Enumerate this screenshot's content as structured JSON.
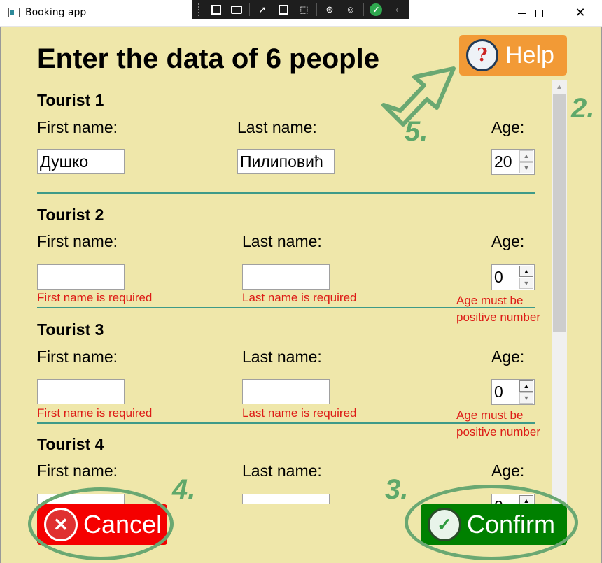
{
  "window": {
    "title": "Booking app",
    "minimize": "",
    "maximize": "",
    "close": "✕"
  },
  "header": {
    "title": "Enter the data of 6 people",
    "help_label": "Help",
    "help_glyph": "?"
  },
  "tourists": [
    {
      "heading": "Tourist 1",
      "first_name_label": "First name:",
      "last_name_label": "Last name:",
      "age_label": "Age:",
      "first_name": "Душко",
      "last_name": "Пилиповић",
      "age": "20",
      "first_name_error": "",
      "last_name_error": "",
      "age_error_line1": "",
      "age_error_line2": ""
    },
    {
      "heading": "Tourist 2",
      "first_name_label": "First name:",
      "last_name_label": "Last name:",
      "age_label": "Age:",
      "first_name": "",
      "last_name": "",
      "age": "0",
      "first_name_error": "First name is required",
      "last_name_error": "Last name is required",
      "age_error_line1": "Age must be",
      "age_error_line2": "positive number"
    },
    {
      "heading": "Tourist 3",
      "first_name_label": "First name:",
      "last_name_label": "Last name:",
      "age_label": "Age:",
      "first_name": "",
      "last_name": "",
      "age": "0",
      "first_name_error": "First name is required",
      "last_name_error": "Last name is required",
      "age_error_line1": "Age must be",
      "age_error_line2": "positive number"
    },
    {
      "heading": "Tourist 4",
      "first_name_label": "First name:",
      "last_name_label": "Last name:",
      "age_label": "Age:",
      "first_name": "",
      "last_name": "",
      "age": "0"
    }
  ],
  "footer": {
    "cancel_label": "Cancel",
    "cancel_glyph": "✕",
    "confirm_label": "Confirm",
    "confirm_glyph": "✓"
  },
  "annotations": {
    "n2": "2.",
    "n3": "3.",
    "n4": "4.",
    "n5": "5."
  },
  "colors": {
    "background": "#efe7aa",
    "help": "#f29a36",
    "cancel": "#f50000",
    "confirm": "#008000",
    "error": "#dd1b16",
    "divider": "#3e9a88",
    "annotation": "#6aa872"
  },
  "icons": {
    "help": "help-question-icon",
    "cancel": "cancel-x-icon",
    "confirm": "confirm-check-icon"
  }
}
